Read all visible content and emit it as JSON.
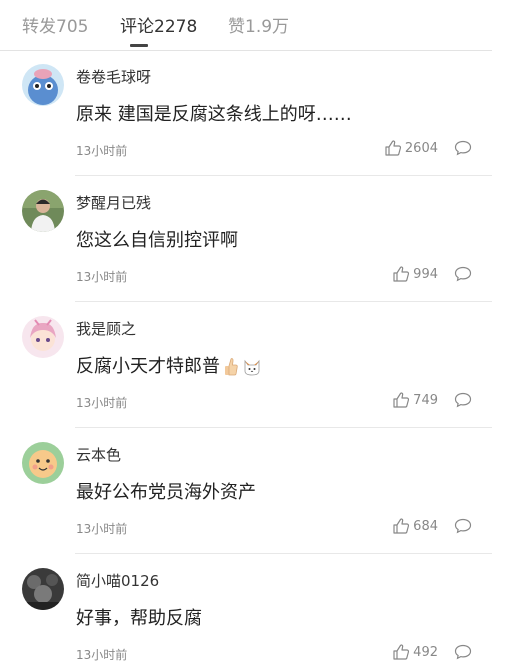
{
  "tabs": [
    {
      "label": "转发705",
      "active": false
    },
    {
      "label": "评论2278",
      "active": true
    },
    {
      "label": "赞1.9万",
      "active": false
    }
  ],
  "comments": [
    {
      "username": "卷卷毛球呀",
      "content": "原来 建国是反腐这条线上的呀……",
      "time": "13小时前",
      "likes": "2604",
      "avatar": "blue-cartoon-avatar"
    },
    {
      "username": "梦醒月已残",
      "content": "您这么自信别控评啊",
      "time": "13小时前",
      "likes": "994",
      "avatar": "person-photo-avatar"
    },
    {
      "username": "我是顾之",
      "content": "反腐小天才特郎普",
      "time": "13小时前",
      "likes": "749",
      "avatar": "anime-girl-avatar",
      "emojis": [
        "thumbs-up-emoji",
        "cat-emoji"
      ]
    },
    {
      "username": "云本色",
      "content": "最好公布党员海外资产",
      "time": "13小时前",
      "likes": "684",
      "avatar": "smiley-face-avatar"
    },
    {
      "username": "简小喵0126",
      "content": "好事，帮助反腐",
      "time": "13小时前",
      "likes": "492",
      "avatar": "dark-photo-avatar"
    }
  ],
  "colors": {
    "text_primary": "#222222",
    "text_secondary": "#888888",
    "tab_inactive": "#999999",
    "divider": "#e8e8e8"
  }
}
